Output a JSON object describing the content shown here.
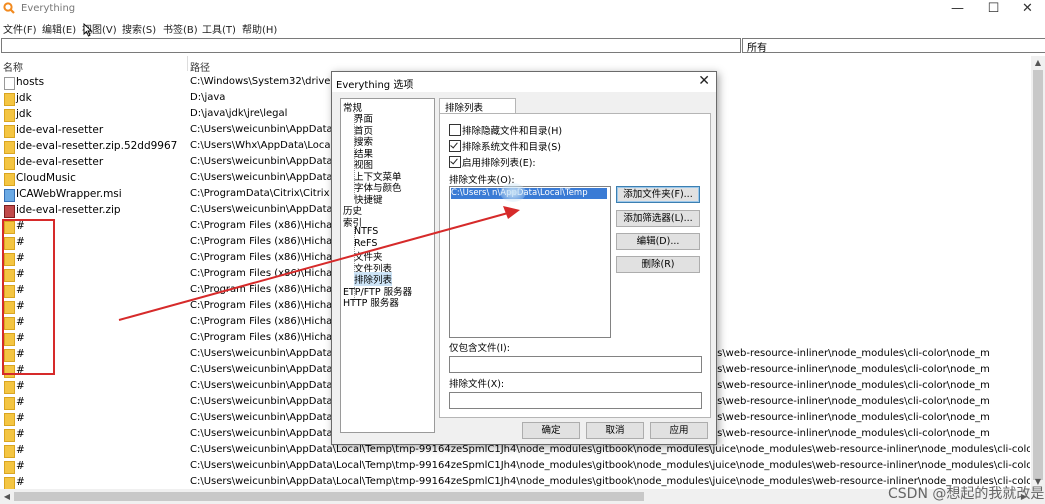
{
  "window": {
    "title": "Everything",
    "minimize": "—",
    "maximize": "☐",
    "close": "✕"
  },
  "menu": [
    "文件(F)",
    "编辑(E)",
    "视图(V)",
    "搜索(S)",
    "书签(B)",
    "工具(T)",
    "帮助(H)"
  ],
  "search": {
    "value": "",
    "filter": "所有"
  },
  "columns": {
    "name": "名称",
    "path": "路径"
  },
  "rows": [
    {
      "name": "hosts",
      "path": "C:\\Windows\\System32\\drivers\\",
      "icon": "file-icon"
    },
    {
      "name": "jdk",
      "path": "D:\\java",
      "icon": "folder-icon"
    },
    {
      "name": "jdk",
      "path": "D:\\java\\jdk\\jre\\legal",
      "icon": "folder-icon"
    },
    {
      "name": "ide-eval-resetter",
      "path": "C:\\Users\\weicunbin\\AppData\\R",
      "icon": "folder-icon"
    },
    {
      "name": "ide-eval-resetter.zip.52dd9967",
      "path": "C:\\Users\\Whx\\AppData\\Local\\",
      "icon": "folder-icon"
    },
    {
      "name": "ide-eval-resetter",
      "path": "C:\\Users\\weicunbin\\AppData\\R",
      "icon": "folder-icon"
    },
    {
      "name": "CloudMusic",
      "path": "C:\\Users\\weicunbin\\AppData\\Lo",
      "icon": "folder-icon"
    },
    {
      "name": "ICAWebWrapper.msi",
      "path": "C:\\ProgramData\\Citrix\\Citrix W",
      "icon": "msi-icon"
    },
    {
      "name": "ide-eval-resetter.zip",
      "path": "C:\\Users\\weicunbin\\AppData\\R",
      "icon": "zip-icon"
    },
    {
      "name": "#",
      "path": "C:\\Program Files (x86)\\HichatX",
      "icon": "folder-icon"
    },
    {
      "name": "#",
      "path": "C:\\Program Files (x86)\\HichatX",
      "icon": "folder-icon"
    },
    {
      "name": "#",
      "path": "C:\\Program Files (x86)\\HichatX",
      "icon": "folder-icon"
    },
    {
      "name": "#",
      "path": "C:\\Program Files (x86)\\HichatX",
      "icon": "folder-icon"
    },
    {
      "name": "#",
      "path": "C:\\Program Files (x86)\\HichatX",
      "icon": "folder-icon"
    },
    {
      "name": "#",
      "path": "C:\\Program Files (x86)\\HichatX",
      "icon": "folder-icon"
    },
    {
      "name": "#",
      "path": "C:\\Program Files (x86)\\HichatX",
      "icon": "folder-icon"
    },
    {
      "name": "#",
      "path": "C:\\Program Files (x86)\\HichatX",
      "icon": "folder-icon"
    },
    {
      "name": "#",
      "path": "C:\\Users\\weicunbin\\AppData\\Lo                                                                                              \\node_modules\\web-resource-inliner\\node_modules\\cli-color\\node_m",
      "icon": "folder-icon"
    },
    {
      "name": "#",
      "path": "C:\\Users\\weicunbin\\AppData\\Lo                                                                                              \\node_modules\\web-resource-inliner\\node_modules\\cli-color\\node_m",
      "icon": "folder-icon"
    },
    {
      "name": "#",
      "path": "C:\\Users\\weicunbin\\AppData\\Lo                                                                                              \\node_modules\\web-resource-inliner\\node_modules\\cli-color\\node_m",
      "icon": "folder-icon"
    },
    {
      "name": "#",
      "path": "C:\\Users\\weicunbin\\AppData\\Lo                                                                                              \\node_modules\\web-resource-inliner\\node_modules\\cli-color\\node_m",
      "icon": "folder-icon"
    },
    {
      "name": "#",
      "path": "C:\\Users\\weicunbin\\AppData\\Lo                                                                                              \\node_modules\\web-resource-inliner\\node_modules\\cli-color\\node_m",
      "icon": "folder-icon"
    },
    {
      "name": "#",
      "path": "C:\\Users\\weicunbin\\AppData\\Lo                                                                                              \\node_modules\\web-resource-inliner\\node_modules\\cli-color\\node_m",
      "icon": "folder-icon"
    },
    {
      "name": "#",
      "path": "C:\\Users\\weicunbin\\AppData\\Local\\Temp\\tmp-99164zeSpmlC1Jh4\\node_modules\\gitbook\\node_modules\\juice\\node_modules\\web-resource-inliner\\node_modules\\cli-color\\node_m",
      "icon": "folder-icon"
    },
    {
      "name": "#",
      "path": "C:\\Users\\weicunbin\\AppData\\Local\\Temp\\tmp-99164zeSpmlC1Jh4\\node_modules\\gitbook\\node_modules\\juice\\node_modules\\web-resource-inliner\\node_modules\\cli-color\\node_m",
      "icon": "folder-icon"
    },
    {
      "name": "#",
      "path": "C:\\Users\\weicunbin\\AppData\\Local\\Temp\\tmp-99164zeSpmlC1Jh4\\node_modules\\gitbook\\node_modules\\juice\\node_modules\\web-resource-inliner\\node_modules\\cli-color\\node_m",
      "icon": "folder-icon"
    }
  ],
  "dialog": {
    "title": "Everything 选项",
    "close": "✕",
    "tree": [
      "常规",
      "界面",
      "首页",
      "搜索",
      "结果",
      "视图",
      "上下文菜单",
      "字体与颜色",
      "快捷键",
      "历史",
      "索引",
      "NTFS",
      "ReFS",
      "文件夹",
      "文件列表",
      "排除列表",
      "ETP/FTP 服务器",
      "HTTP 服务器"
    ],
    "tab": "排除列表",
    "checkboxes": [
      {
        "label": "排除隐藏文件和目录(H)",
        "checked": false
      },
      {
        "label": "排除系统文件和目录(S)",
        "checked": true
      },
      {
        "label": "启用排除列表(E):",
        "checked": true
      }
    ],
    "folders_label": "排除文件夹(O):",
    "folders": [
      "C:\\Users\\            n\\AppData\\Local\\Temp"
    ],
    "side_buttons": [
      "添加文件夹(F)...",
      "添加筛选器(L)...",
      "编辑(D)...",
      "删除(R)"
    ],
    "include_label": "仅包含文件(I):",
    "include_value": "",
    "exclude_label": "排除文件(X):",
    "exclude_value": "",
    "footer_buttons": [
      "确定",
      "取消",
      "应用"
    ]
  },
  "watermark": "CSDN @想起的我就改是"
}
